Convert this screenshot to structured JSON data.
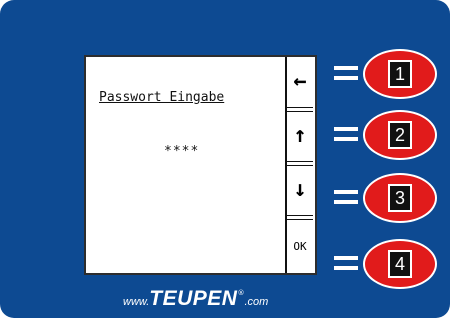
{
  "screen": {
    "title": "Passwort Eingabe",
    "password_mask": "****",
    "softkeys": [
      {
        "icon": "arrow-left-icon",
        "symbol": "←"
      },
      {
        "icon": "arrow-up-icon",
        "symbol": "↑"
      },
      {
        "icon": "arrow-down-icon",
        "symbol": "↓"
      },
      {
        "icon": "ok-label",
        "symbol": "OK"
      }
    ]
  },
  "keys": [
    {
      "number": "1"
    },
    {
      "number": "2"
    },
    {
      "number": "3"
    },
    {
      "number": "4"
    }
  ],
  "logo": {
    "prefix": "www.",
    "brand": "TEUPEN",
    "registered": "®",
    "suffix": ".com"
  },
  "colors": {
    "panel": "#0d4a92",
    "key_fill": "#e11b1b",
    "screen": "#ffffff"
  }
}
